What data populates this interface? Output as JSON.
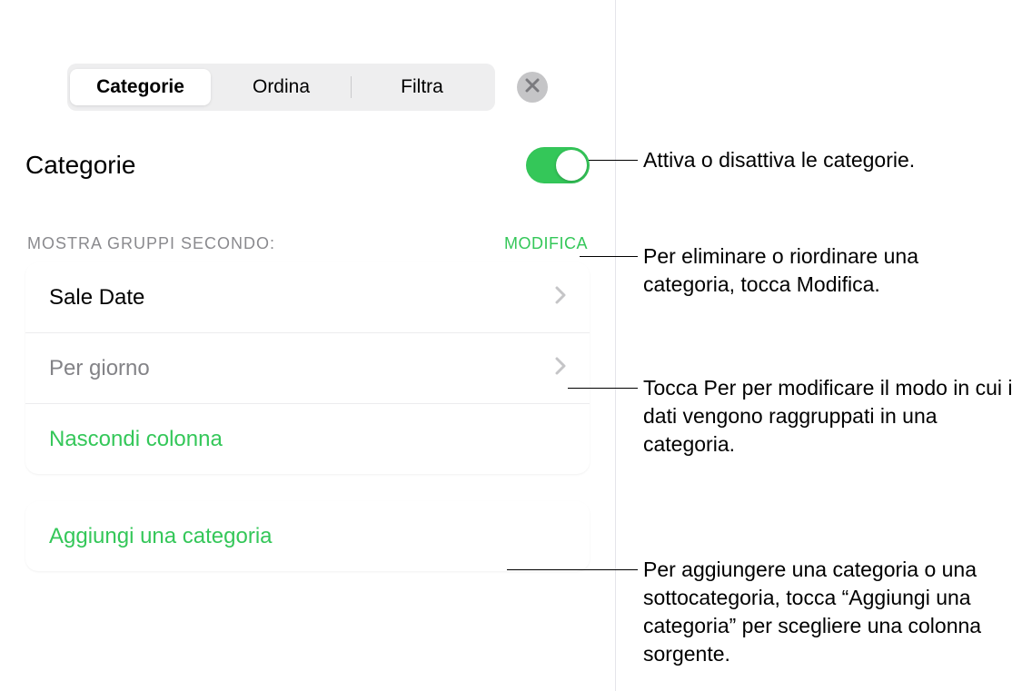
{
  "tabs": {
    "categorie": "Categorie",
    "ordina": "Ordina",
    "filtra": "Filtra"
  },
  "section": {
    "title": "Categorie"
  },
  "group": {
    "header": "MOSTRA GRUPPI SECONDO:",
    "edit": "MODIFICA"
  },
  "rows": {
    "primary": "Sale Date",
    "by_interval": "Per giorno",
    "hide_column": "Nascondi colonna",
    "add_category": "Aggiungi una categoria"
  },
  "callouts": {
    "toggle": "Attiva o disattiva le categorie.",
    "modifica": "Per eliminare o riordinare una categoria, tocca Modifica.",
    "per": "Tocca Per per modificare il modo in cui i dati vengono raggruppati in una categoria.",
    "aggiungi": "Per aggiungere una categoria o una sottocategoria, tocca “Aggiungi una categoria” per scegliere una colonna sorgente."
  },
  "colors": {
    "accent": "#34C759"
  }
}
